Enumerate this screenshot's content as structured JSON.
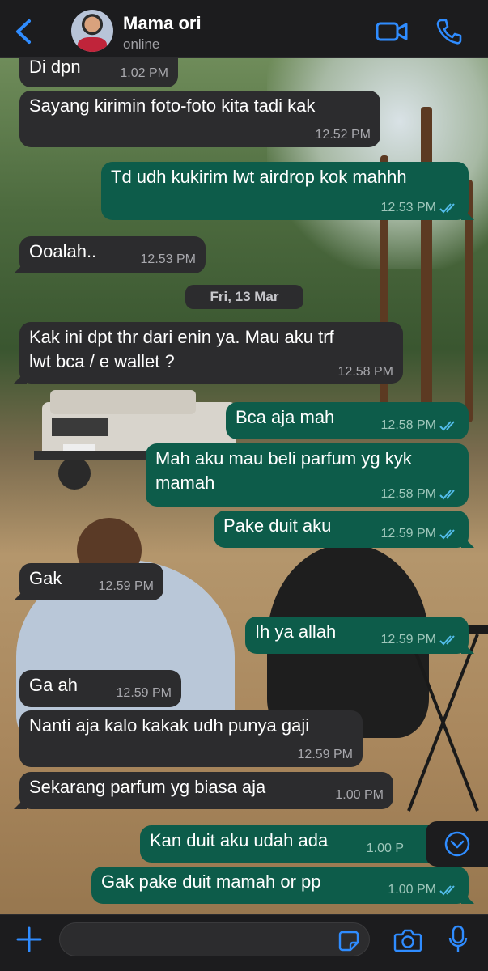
{
  "header": {
    "contact_name": "Mama ori",
    "status": "online",
    "icons": [
      "chevron-left-icon",
      "video-camera-icon",
      "phone-icon"
    ]
  },
  "messages": [
    {
      "dir": "in",
      "text": "Di dpn",
      "time": "1.02 PM"
    },
    {
      "dir": "in",
      "text": "Sayang kirimin foto-foto kita tadi kak",
      "time": "12.52 PM"
    },
    {
      "dir": "out",
      "text": "Td udh kukirim lwt airdrop kok mahhh",
      "time": "12.53 PM",
      "read": true
    },
    {
      "dir": "in",
      "text": "Ooalah..",
      "time": "12.53 PM"
    },
    {
      "dir": "in",
      "text_line1": "Kak ini dpt thr dari enin ya. Mau aku trf",
      "text_line2": "lwt bca / e wallet ?",
      "time": "12.58 PM"
    },
    {
      "dir": "out",
      "text": "Bca aja mah",
      "time": "12.58 PM",
      "read": true
    },
    {
      "dir": "out",
      "text_line1": "Mah aku mau beli parfum yg kyk",
      "text_line2": "mamah",
      "time": "12.58 PM",
      "read": true
    },
    {
      "dir": "out",
      "text": "Pake duit aku",
      "time": "12.59 PM",
      "read": true
    },
    {
      "dir": "in",
      "text": "Gak",
      "time": "12.59 PM"
    },
    {
      "dir": "out",
      "text": "Ih ya allah",
      "time": "12.59 PM",
      "read": true
    },
    {
      "dir": "in",
      "text": "Ga ah",
      "time": "12.59 PM"
    },
    {
      "dir": "in",
      "text": "Nanti aja kalo kakak udh punya gaji",
      "time": "12.59 PM"
    },
    {
      "dir": "in",
      "text": "Sekarang parfum yg biasa aja",
      "time": "1.00 PM"
    },
    {
      "dir": "out",
      "text": "Kan duit aku udah ada",
      "time": "1.00 P",
      "read": true
    },
    {
      "dir": "out",
      "text": "Gak pake duit mamah or pp",
      "time": "1.00 PM",
      "read": true
    }
  ],
  "date_separator": "Fri, 13 Mar",
  "input": {
    "value": "",
    "placeholder": ""
  },
  "colors": {
    "incoming_bubble": "#2c2c2e",
    "outgoing_bubble": "#0d5c4a",
    "accent": "#2f8cff",
    "read_ticks": "#53bdeb"
  }
}
